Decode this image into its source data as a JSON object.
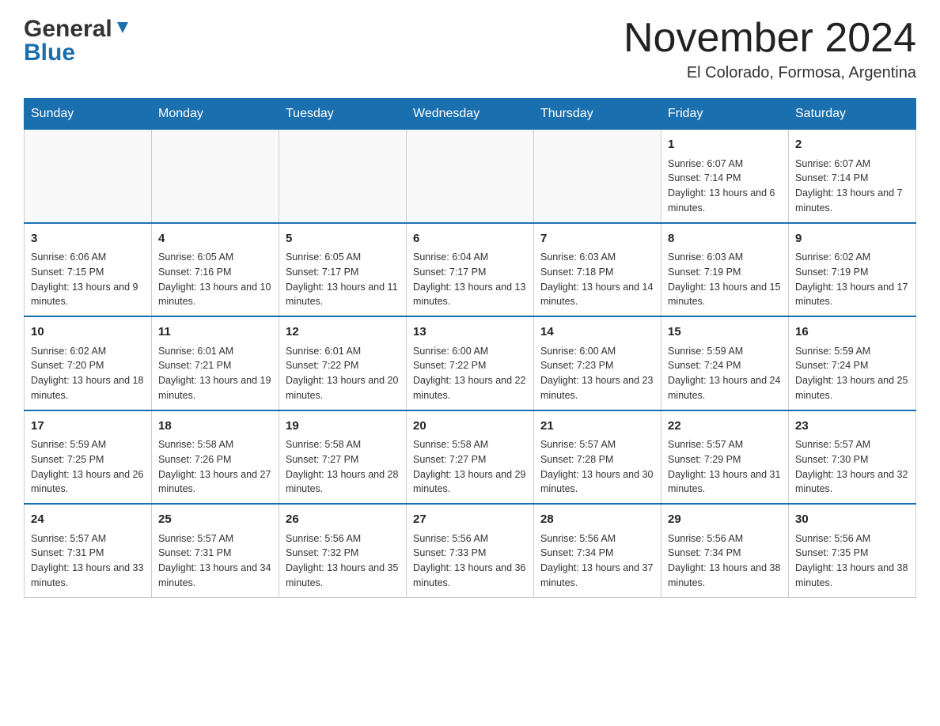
{
  "header": {
    "logo_general": "General",
    "logo_blue": "Blue",
    "month_title": "November 2024",
    "location": "El Colorado, Formosa, Argentina"
  },
  "days_of_week": [
    "Sunday",
    "Monday",
    "Tuesday",
    "Wednesday",
    "Thursday",
    "Friday",
    "Saturday"
  ],
  "weeks": [
    [
      {
        "day": "",
        "info": ""
      },
      {
        "day": "",
        "info": ""
      },
      {
        "day": "",
        "info": ""
      },
      {
        "day": "",
        "info": ""
      },
      {
        "day": "",
        "info": ""
      },
      {
        "day": "1",
        "info": "Sunrise: 6:07 AM\nSunset: 7:14 PM\nDaylight: 13 hours and 6 minutes."
      },
      {
        "day": "2",
        "info": "Sunrise: 6:07 AM\nSunset: 7:14 PM\nDaylight: 13 hours and 7 minutes."
      }
    ],
    [
      {
        "day": "3",
        "info": "Sunrise: 6:06 AM\nSunset: 7:15 PM\nDaylight: 13 hours and 9 minutes."
      },
      {
        "day": "4",
        "info": "Sunrise: 6:05 AM\nSunset: 7:16 PM\nDaylight: 13 hours and 10 minutes."
      },
      {
        "day": "5",
        "info": "Sunrise: 6:05 AM\nSunset: 7:17 PM\nDaylight: 13 hours and 11 minutes."
      },
      {
        "day": "6",
        "info": "Sunrise: 6:04 AM\nSunset: 7:17 PM\nDaylight: 13 hours and 13 minutes."
      },
      {
        "day": "7",
        "info": "Sunrise: 6:03 AM\nSunset: 7:18 PM\nDaylight: 13 hours and 14 minutes."
      },
      {
        "day": "8",
        "info": "Sunrise: 6:03 AM\nSunset: 7:19 PM\nDaylight: 13 hours and 15 minutes."
      },
      {
        "day": "9",
        "info": "Sunrise: 6:02 AM\nSunset: 7:19 PM\nDaylight: 13 hours and 17 minutes."
      }
    ],
    [
      {
        "day": "10",
        "info": "Sunrise: 6:02 AM\nSunset: 7:20 PM\nDaylight: 13 hours and 18 minutes."
      },
      {
        "day": "11",
        "info": "Sunrise: 6:01 AM\nSunset: 7:21 PM\nDaylight: 13 hours and 19 minutes."
      },
      {
        "day": "12",
        "info": "Sunrise: 6:01 AM\nSunset: 7:22 PM\nDaylight: 13 hours and 20 minutes."
      },
      {
        "day": "13",
        "info": "Sunrise: 6:00 AM\nSunset: 7:22 PM\nDaylight: 13 hours and 22 minutes."
      },
      {
        "day": "14",
        "info": "Sunrise: 6:00 AM\nSunset: 7:23 PM\nDaylight: 13 hours and 23 minutes."
      },
      {
        "day": "15",
        "info": "Sunrise: 5:59 AM\nSunset: 7:24 PM\nDaylight: 13 hours and 24 minutes."
      },
      {
        "day": "16",
        "info": "Sunrise: 5:59 AM\nSunset: 7:24 PM\nDaylight: 13 hours and 25 minutes."
      }
    ],
    [
      {
        "day": "17",
        "info": "Sunrise: 5:59 AM\nSunset: 7:25 PM\nDaylight: 13 hours and 26 minutes."
      },
      {
        "day": "18",
        "info": "Sunrise: 5:58 AM\nSunset: 7:26 PM\nDaylight: 13 hours and 27 minutes."
      },
      {
        "day": "19",
        "info": "Sunrise: 5:58 AM\nSunset: 7:27 PM\nDaylight: 13 hours and 28 minutes."
      },
      {
        "day": "20",
        "info": "Sunrise: 5:58 AM\nSunset: 7:27 PM\nDaylight: 13 hours and 29 minutes."
      },
      {
        "day": "21",
        "info": "Sunrise: 5:57 AM\nSunset: 7:28 PM\nDaylight: 13 hours and 30 minutes."
      },
      {
        "day": "22",
        "info": "Sunrise: 5:57 AM\nSunset: 7:29 PM\nDaylight: 13 hours and 31 minutes."
      },
      {
        "day": "23",
        "info": "Sunrise: 5:57 AM\nSunset: 7:30 PM\nDaylight: 13 hours and 32 minutes."
      }
    ],
    [
      {
        "day": "24",
        "info": "Sunrise: 5:57 AM\nSunset: 7:31 PM\nDaylight: 13 hours and 33 minutes."
      },
      {
        "day": "25",
        "info": "Sunrise: 5:57 AM\nSunset: 7:31 PM\nDaylight: 13 hours and 34 minutes."
      },
      {
        "day": "26",
        "info": "Sunrise: 5:56 AM\nSunset: 7:32 PM\nDaylight: 13 hours and 35 minutes."
      },
      {
        "day": "27",
        "info": "Sunrise: 5:56 AM\nSunset: 7:33 PM\nDaylight: 13 hours and 36 minutes."
      },
      {
        "day": "28",
        "info": "Sunrise: 5:56 AM\nSunset: 7:34 PM\nDaylight: 13 hours and 37 minutes."
      },
      {
        "day": "29",
        "info": "Sunrise: 5:56 AM\nSunset: 7:34 PM\nDaylight: 13 hours and 38 minutes."
      },
      {
        "day": "30",
        "info": "Sunrise: 5:56 AM\nSunset: 7:35 PM\nDaylight: 13 hours and 38 minutes."
      }
    ]
  ]
}
